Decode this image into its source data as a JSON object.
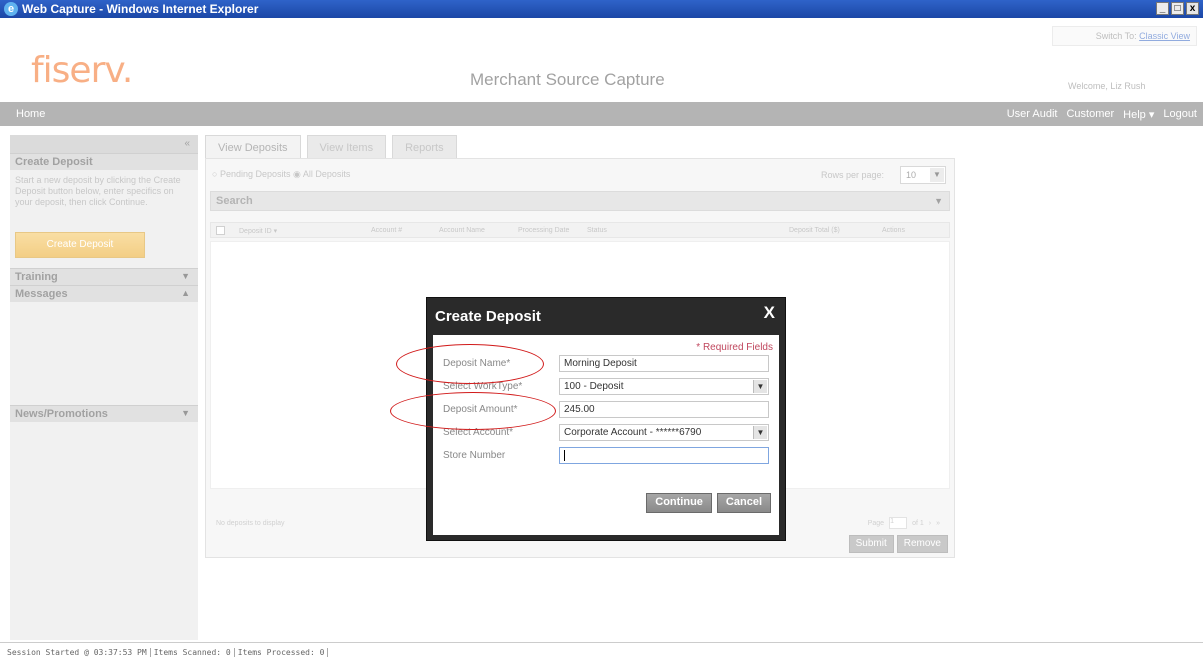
{
  "window": {
    "title": "Web Capture - Windows Internet Explorer",
    "controls": [
      "_",
      "□",
      "x"
    ]
  },
  "header": {
    "logo": "fiserv.",
    "app_title": "Merchant Source Capture",
    "switch_label": "Switch To:",
    "switch_link": "Classic View",
    "welcome": "Welcome, Liz Rush"
  },
  "nav": {
    "home": "Home",
    "items": [
      "User Audit",
      "Customer",
      "Help ▾",
      "Logout"
    ]
  },
  "sidebar": {
    "create_deposit_title": "Create Deposit",
    "create_deposit_text": "Start a new deposit by clicking the Create Deposit button below, enter specifics on your deposit, then click Continue.",
    "create_deposit_button": "Create Deposit",
    "training": "Training",
    "messages": "Messages",
    "news": "News/Promotions"
  },
  "tabs": [
    "View Deposits",
    "View Items",
    "Reports"
  ],
  "deposits": {
    "radio_pending": "Pending Deposits",
    "radio_all": "All Deposits",
    "rows_per_page_label": "Rows per page:",
    "rows_per_page_value": "10",
    "search_label": "Search",
    "columns": [
      "Deposit ID ▾",
      "Account #",
      "Account Name",
      "Processing Date",
      "Status",
      "Deposit Total ($)",
      "Actions"
    ],
    "empty_text": "No deposits to display",
    "pager": {
      "page_label": "Page",
      "page_value": "1",
      "of": "of 1"
    },
    "submit": "Submit",
    "remove": "Remove"
  },
  "modal": {
    "title": "Create Deposit",
    "close": "X",
    "required_note": "* Required Fields",
    "fields": [
      {
        "label": "Deposit Name*",
        "value": "Morning Deposit"
      },
      {
        "label": "Select WorkType*",
        "value": "100 - Deposit"
      },
      {
        "label": "Deposit Amount*",
        "value": "245.00"
      },
      {
        "label": "Select Account*",
        "value": "Corporate Account - ******6790"
      },
      {
        "label": "Store Number",
        "value": ""
      }
    ],
    "continue": "Continue",
    "cancel": "Cancel"
  },
  "status_bar": [
    "Session Started @ 03:37:53 PM",
    "Items Scanned: 0",
    "Items Processed: 0"
  ],
  "colors": {
    "logo": "#f26d21",
    "titlebar": "#1b47a6",
    "accent_button": "#e9a622",
    "annotation": "#d11a1a"
  }
}
